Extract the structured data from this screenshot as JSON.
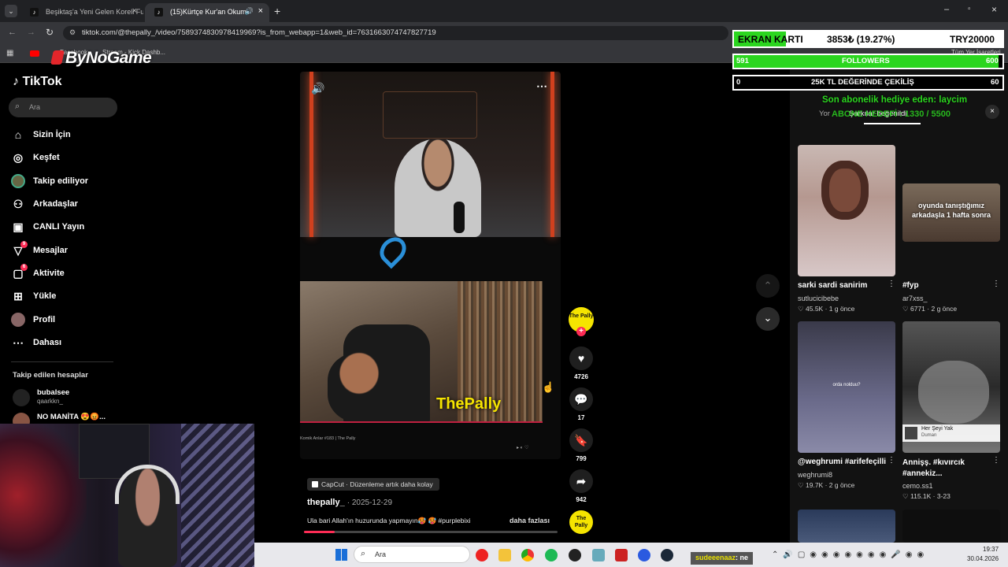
{
  "browser": {
    "tabs": [
      {
        "label": "Beşiktaş'a Yeni Gelen Koreli Futb"
      },
      {
        "label": "(15)Kürtçe Kur'an Okumanın"
      }
    ],
    "url": "tiktok.com/@thepally_/video/7589374830978419969?is_from_webapp=1&web_id=7631663074747827719",
    "bookmarks": [
      "Facebook",
      "Stream - Kick Dashb..."
    ],
    "bookmarks_right": "Tüm Yer İşaretleri"
  },
  "stream_logo": "ByNoGame",
  "tiktok": {
    "brand": "TikTok",
    "search_placeholder": "Ara",
    "nav": [
      {
        "label": "Sizin İçin",
        "icon": "home-icon"
      },
      {
        "label": "Keşfet",
        "icon": "compass-icon"
      },
      {
        "label": "Takip ediliyor",
        "icon": "following-icon"
      },
      {
        "label": "Arkadaşlar",
        "icon": "friends-icon"
      },
      {
        "label": "CANLI Yayın",
        "icon": "live-icon"
      },
      {
        "label": "Mesajlar",
        "icon": "messages-icon",
        "badge": "9"
      },
      {
        "label": "Aktivite",
        "icon": "activity-icon",
        "badge": "6"
      },
      {
        "label": "Yükle",
        "icon": "upload-icon"
      },
      {
        "label": "Profil",
        "icon": "profile-icon"
      },
      {
        "label": "Dahası",
        "icon": "more-icon"
      }
    ],
    "following_header": "Takip edilen hesaplar",
    "following": [
      {
        "name": "bubalsee",
        "handle": "qaarkkn_"
      },
      {
        "name": "NO MANİTA 😍😡...",
        "handle": ""
      }
    ]
  },
  "video": {
    "overlay_name": "ThePally",
    "capcut_label": "CapCut · Düzenleme artık daha kolay",
    "author": "thepally_",
    "date": "· 2025-12-29",
    "caption": "Ula bari Allah'ın huzurunda yapmayın🥵 🥵 #purplebixi",
    "more": "daha fazlası",
    "inner_caption": "Komik Anlar #183 | The Pally"
  },
  "actions": {
    "avatar_text": "The Pally",
    "likes": "4726",
    "comments": "17",
    "saves": "799",
    "shares": "942"
  },
  "right_panel": {
    "tabs_text": "Şarkılar beğenildi",
    "tab_left": "Yor",
    "cards": [
      {
        "title": "sarki sardi sanirim",
        "user": "sutlucicibebe",
        "likes": "45.5K",
        "age": "1 g önce"
      },
      {
        "title": "#fyp",
        "user": "ar7xss_",
        "likes": "6771",
        "age": "2 g önce",
        "overlay": "oyunda tanıştığımız arkadaşla 1 hafta sonra"
      },
      {
        "title": "@weghrumi #arifefeçilli",
        "user": "weghrumi8",
        "likes": "19.7K",
        "age": "2 g önce",
        "overlay": "orda nolduu?"
      },
      {
        "title": "Annişş. #kıvırcık #annekiz...",
        "user": "cemo.ss1",
        "likes": "115.1K",
        "age": "3-23",
        "song": "Her Şeyi Yak",
        "artist": "Duman"
      }
    ]
  },
  "stream_overlay": {
    "goal_label": "EKRAN KARTI",
    "goal_progress": "3853₺ (19.27%)",
    "goal_target": "TRY20000",
    "goal_fraction": 0.1927,
    "followers_left": "591",
    "followers_label": "FOLLOWERS",
    "followers_right": "600",
    "followers_fraction": 0.985,
    "raffle_left": "0",
    "raffle_label": "25K TL DEĞERİNDE ÇEKİLİŞ",
    "raffle_right": "60",
    "sub_line1": "Son abonelik hediye eden: laycim",
    "sub_line2": "ABONE HEDEFİ : 1330 / 5500"
  },
  "taskbar": {
    "search": "Ara",
    "chat_user": "sudeeenaaz",
    "chat_suffix": ": ne",
    "time": "19:37",
    "date": "30.04.2026"
  },
  "colors": {
    "tiktok_red": "#fe2c55",
    "overlay_green": "#2bd61f",
    "yellow": "#f5e400"
  }
}
